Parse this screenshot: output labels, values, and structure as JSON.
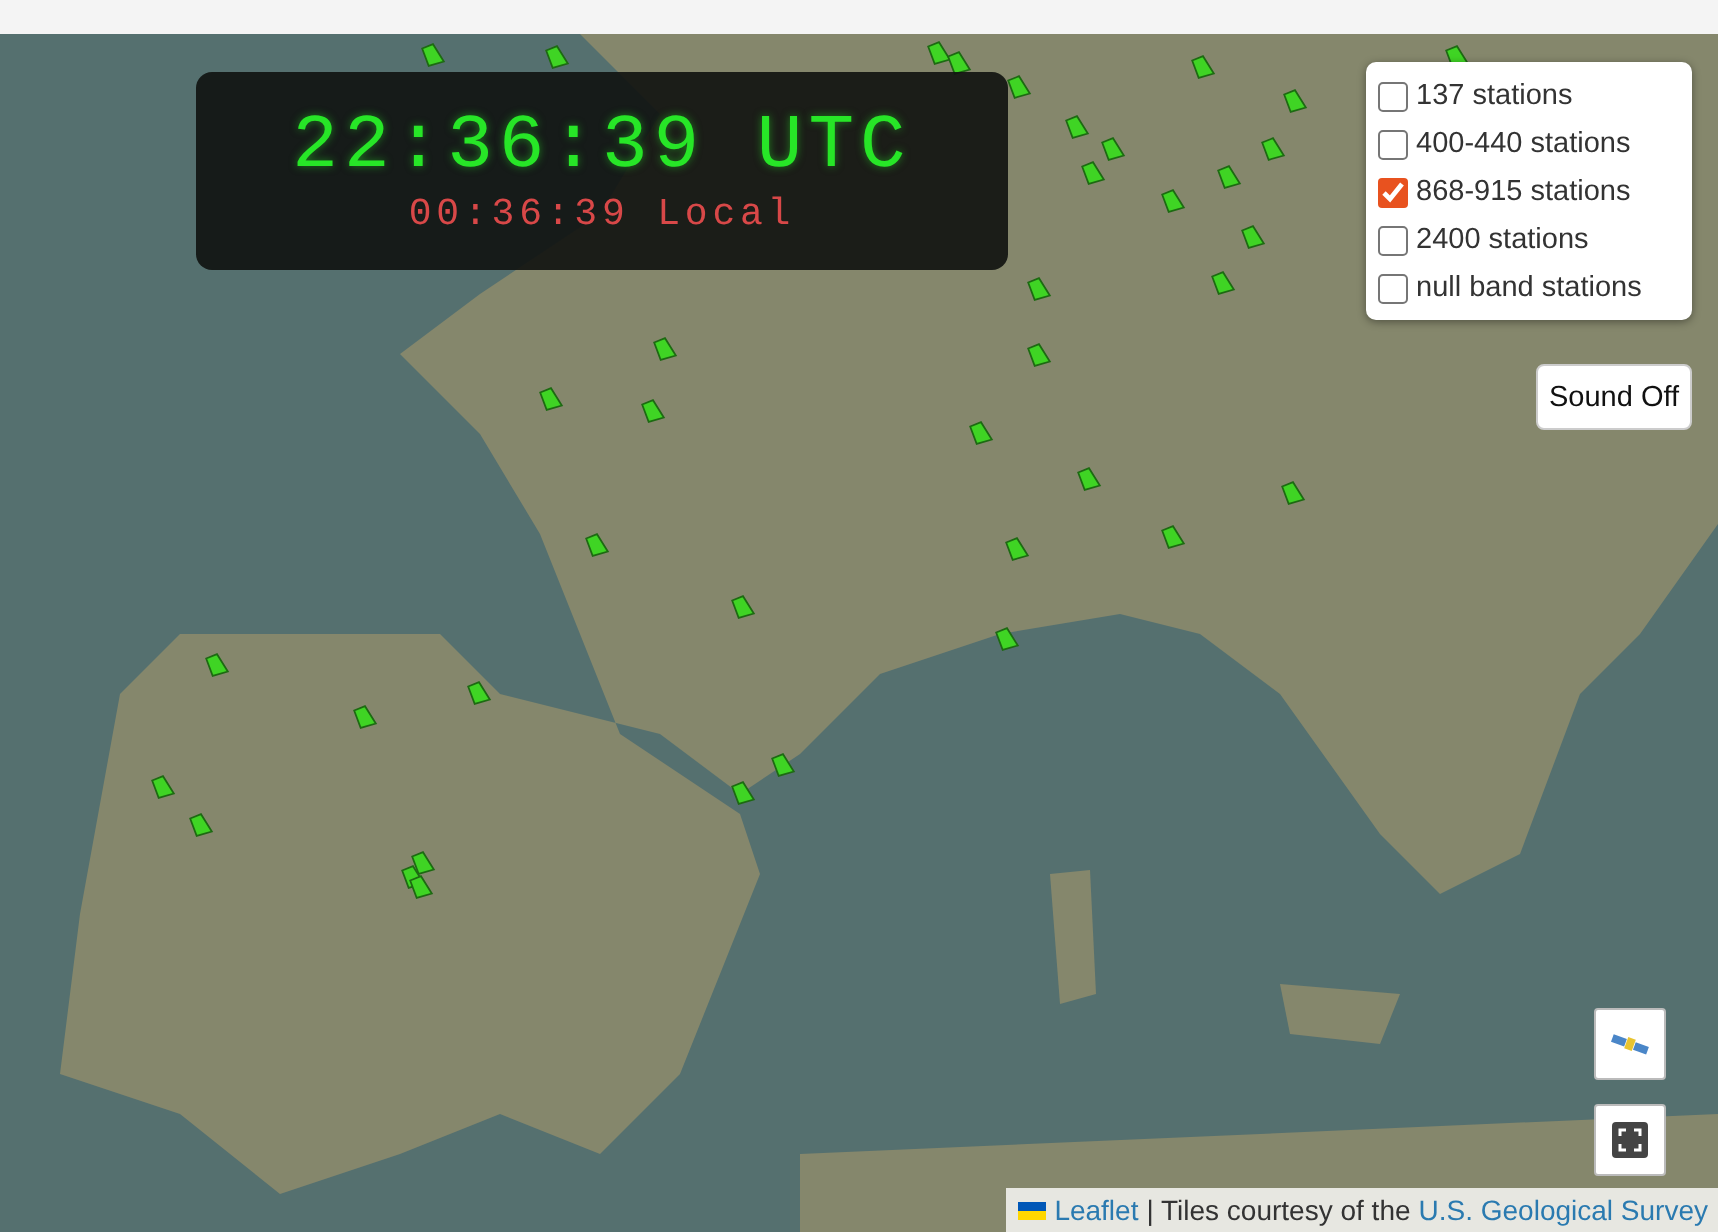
{
  "clock": {
    "utc": "22:36:39 UTC",
    "local": "00:36:39 Local"
  },
  "layers": [
    {
      "label": "137 stations",
      "checked": false
    },
    {
      "label": "400-440 stations",
      "checked": false
    },
    {
      "label": "868-915 stations",
      "checked": true
    },
    {
      "label": "2400 stations",
      "checked": false
    },
    {
      "label": "null band stations",
      "checked": false
    }
  ],
  "sound_button": "Sound Off",
  "attribution": {
    "leaflet_link": "Leaflet",
    "text": "| Tiles courtesy of the",
    "source_link": "U.S. Geological Survey"
  }
}
